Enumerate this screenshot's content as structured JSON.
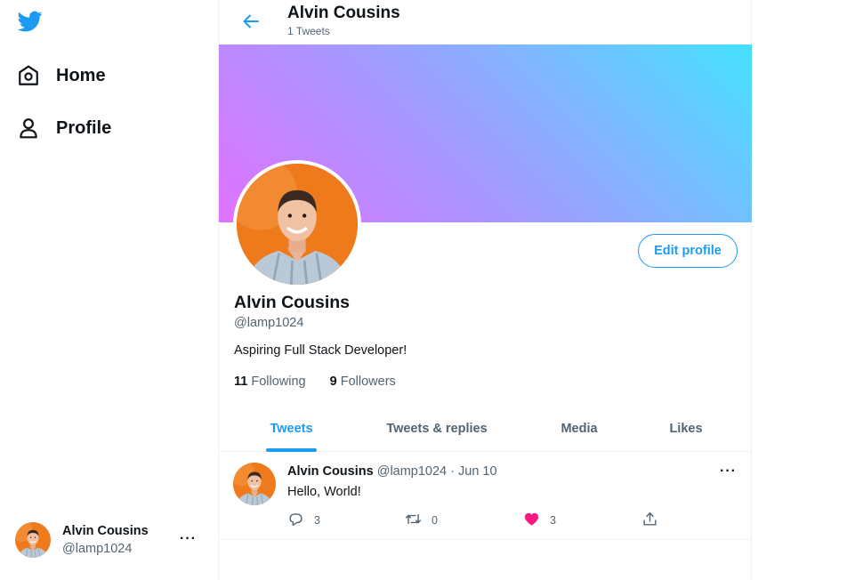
{
  "nav": {
    "home_label": "Home",
    "profile_label": "Profile"
  },
  "account": {
    "name": "Alvin Cousins",
    "handle": "@lamp1024",
    "more": "···"
  },
  "header": {
    "title": "Alvin Cousins",
    "subtitle": "1 Tweets"
  },
  "profile": {
    "edit_label": "Edit profile",
    "name": "Alvin Cousins",
    "handle": "@lamp1024",
    "bio": "Aspiring Full Stack Developer!",
    "following_count": "11",
    "following_label": "Following",
    "followers_count": "9",
    "followers_label": "Followers"
  },
  "tabs": [
    {
      "label": "Tweets",
      "active": true
    },
    {
      "label": "Tweets & replies",
      "active": false
    },
    {
      "label": "Media",
      "active": false
    },
    {
      "label": "Likes",
      "active": false
    }
  ],
  "tweet": {
    "name": "Alvin Cousins",
    "meta": "@lamp1024 · Jun 10",
    "text": "Hello, World!",
    "more": "···",
    "replies": "3",
    "retweets": "0",
    "likes": "3"
  },
  "colors": {
    "accent": "#1d9bf0",
    "like": "#f91880",
    "avatar_bg": "#ef7a1c"
  },
  "icons": {
    "logo": "twitter-bird-icon",
    "home": "home-icon",
    "profile": "person-icon",
    "back": "arrow-left-icon",
    "reply": "reply-icon",
    "retweet": "retweet-icon",
    "like": "heart-filled-icon",
    "share": "share-icon"
  }
}
